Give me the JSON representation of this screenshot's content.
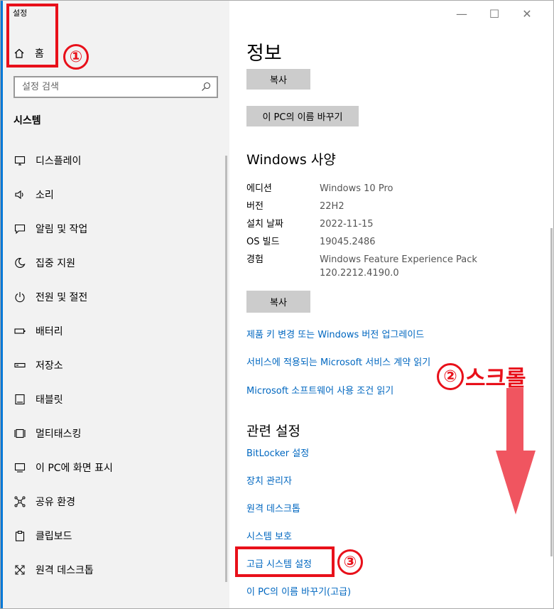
{
  "app": {
    "title": "설정"
  },
  "window_controls": {
    "minimize": "—",
    "maximize": "☐",
    "close": "✕"
  },
  "sidebar": {
    "home_label": "홈",
    "search_placeholder": "설정 검색",
    "section_title": "시스템",
    "items": [
      {
        "label": "디스플레이",
        "icon": "monitor-icon"
      },
      {
        "label": "소리",
        "icon": "speaker-icon"
      },
      {
        "label": "알림 및 작업",
        "icon": "message-icon"
      },
      {
        "label": "집중 지원",
        "icon": "moon-icon"
      },
      {
        "label": "전원 및 절전",
        "icon": "power-icon"
      },
      {
        "label": "배터리",
        "icon": "battery-icon"
      },
      {
        "label": "저장소",
        "icon": "storage-icon"
      },
      {
        "label": "태블릿",
        "icon": "tablet-icon"
      },
      {
        "label": "멀티태스킹",
        "icon": "multitask-icon"
      },
      {
        "label": "이 PC에 화면 표시",
        "icon": "project-icon"
      },
      {
        "label": "공유 환경",
        "icon": "share-icon"
      },
      {
        "label": "클립보드",
        "icon": "clipboard-icon"
      },
      {
        "label": "원격 데스크톱",
        "icon": "remote-icon"
      }
    ]
  },
  "main": {
    "title": "정보",
    "copy_button_1": "복사",
    "rename_button": "이 PC의 이름 바꾸기",
    "windows_spec_title": "Windows 사양",
    "spec": [
      {
        "key": "에디션",
        "value": "Windows 10 Pro"
      },
      {
        "key": "버전",
        "value": "22H2"
      },
      {
        "key": "설치 날짜",
        "value": "2022-11-15"
      },
      {
        "key": "OS 빌드",
        "value": "19045.2486"
      },
      {
        "key": "경험",
        "value": "Windows Feature Experience Pack\n120.2212.4190.0"
      }
    ],
    "copy_button_2": "복사",
    "links": [
      "제품 키 변경 또는 Windows 버전 업그레이드",
      "서비스에 적용되는 Microsoft 서비스 계약 읽기",
      "Microsoft 소프트웨어 사용 조건 읽기"
    ],
    "related_title": "관련 설정",
    "related_links": [
      "BitLocker 설정",
      "장치 관리자",
      "원격 데스크톱",
      "시스템 보호",
      "고급 시스템 설정",
      "이 PC의 이름 바꾸기(고급)"
    ]
  },
  "annotations": {
    "num1": "①",
    "num2": "②",
    "num3": "③",
    "scroll_text": "스크롤",
    "color": "#e8101a",
    "arrow_color": "#f05560"
  }
}
